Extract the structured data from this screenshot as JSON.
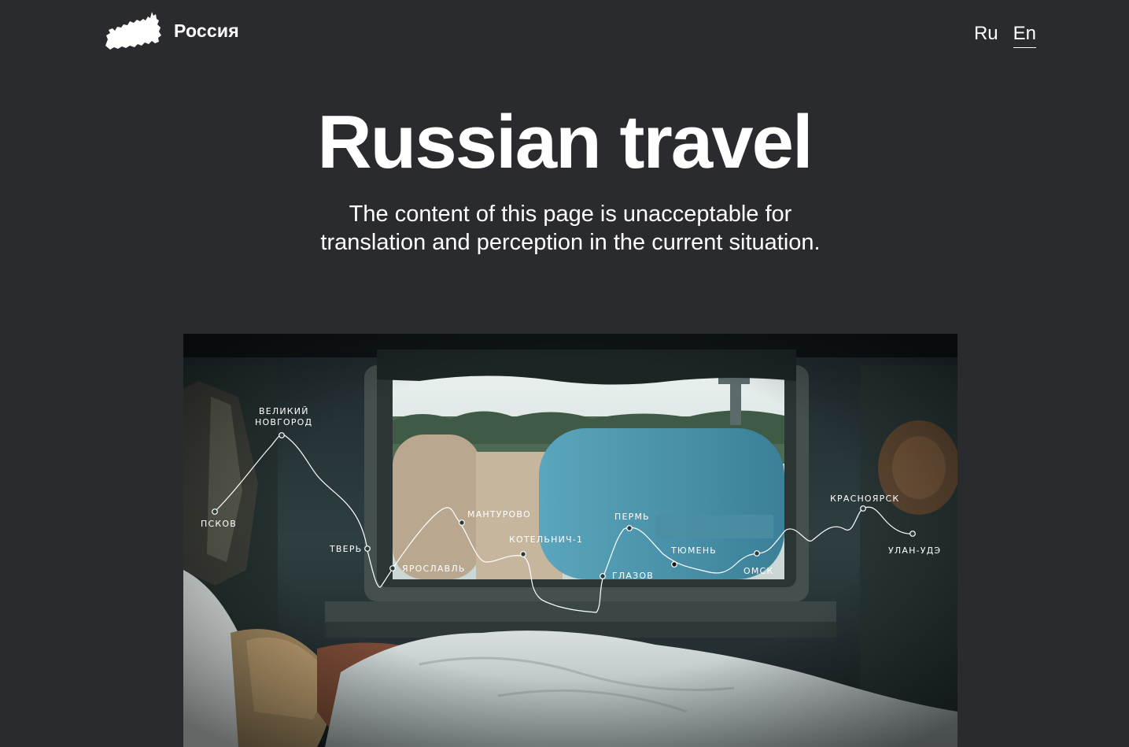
{
  "header": {
    "brand_name": "Россия",
    "languages": [
      {
        "label": "Ru",
        "active": false
      },
      {
        "label": "En",
        "active": true
      }
    ]
  },
  "hero": {
    "title": "Russian travel",
    "subtitle": "The content of this page is unacceptable for translation and perception in the current situation."
  },
  "route": {
    "stops": {
      "pskov": "ПСКОВ",
      "novgorod_1": "ВЕЛИКИЙ",
      "novgorod_2": "НОВГОРОД",
      "tver": "ТВЕРЬ",
      "yaroslavl": "ЯРОСЛАВЛЬ",
      "manturovo": "МАНТУРОВО",
      "kotelnich": "КОТЕЛЬНИЧ-1",
      "glazov": "ГЛАЗОВ",
      "perm": "ПЕРМЬ",
      "tyumen": "ТЮМЕНЬ",
      "omsk": "ОМСК",
      "krasnoyarsk": "КРАСНОЯРСК",
      "ulan_ude": "УЛАН-УДЭ"
    }
  },
  "icons": {
    "logo": "russia-map-icon"
  },
  "colors": {
    "background": "#2a2b2f",
    "text": "#ffffff"
  }
}
